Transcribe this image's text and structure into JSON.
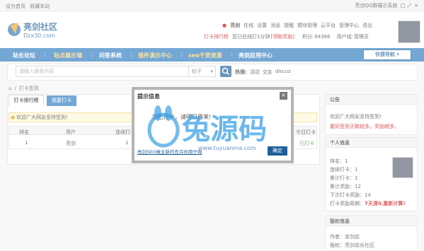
{
  "topbar": {
    "set_home": "设为首页",
    "bookmark": "收藏本站",
    "qq_system": "亮剑QQ群展示系统"
  },
  "logo": {
    "name": "亮剑社区",
    "url_text": "Dzx30.com"
  },
  "userbar": {
    "username": "亮剑",
    "status": "在线",
    "links": [
      "设置",
      "消息",
      "提醒",
      "模块管理",
      "云平台",
      "管理中心",
      "退出"
    ],
    "rank_link": "打卡排行榜",
    "checkin_text": "您已在线打1分钟",
    "reward": "[领取奖励]",
    "points_label": "积分:",
    "points_value": "94366",
    "group_label": "用户组:",
    "group_value": "管理员"
  },
  "nav": {
    "items": [
      "站长论坛",
      "站点展示墙",
      "问答系统",
      "插件演示中心",
      "seo干货资源",
      "亮剑应用中心"
    ],
    "quick_nav": "快捷导航"
  },
  "search": {
    "placeholder": "请输入搜索内容",
    "type": "帖子",
    "hot_label": "热搜:",
    "hot_items": [
      "活动",
      "交友",
      "discuz"
    ]
  },
  "breadcrumb": {
    "current": "打卡签到"
  },
  "tabs": {
    "rank": "打卡排行榜",
    "checkin": "我要打卡"
  },
  "notice": "欢迎广大网友坚持签到!",
  "table": {
    "headers": [
      "排名",
      "用户",
      "连续打卡天",
      "今日打卡"
    ],
    "row": {
      "rank": "1",
      "user": "亮剑",
      "days": "1",
      "status": "已打卡"
    }
  },
  "announce": {
    "title": "公告",
    "line1": "欢迎广大网友坚持签到!",
    "line2": "要好签到天数越多，奖励越多。"
  },
  "profile": {
    "title": "个人信息",
    "rank": "排名：1",
    "continuous": "连续打卡：1",
    "total": "累计打卡：1",
    "reward": "累计奖励：12",
    "next": "下次打卡奖励：14",
    "period_label": "打卡奖励周期：",
    "period_value": "7天清0,重新计算!"
  },
  "copyright": {
    "title": "版权信息",
    "author": "作者：余剑启",
    "org": "版权：亮剑站长社区"
  },
  "dialog": {
    "title": "提示信息",
    "message": "您已打卡，请明日再来!",
    "link": "亮剑SEO做业新的先许你用于网",
    "ok": "确定",
    "close": "×"
  },
  "watermark": {
    "text": "兔源码",
    "url": "www.tuyuanma.com"
  },
  "colors": {
    "nav": "#2a79bd",
    "accent": "#1d5f98",
    "warn": "#cc0000"
  }
}
